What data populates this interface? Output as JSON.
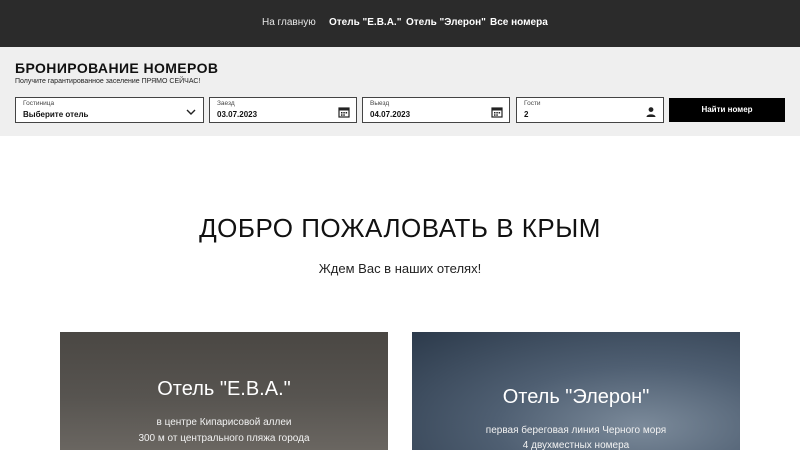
{
  "nav": {
    "items": [
      {
        "label": "На главную"
      },
      {
        "label": "Отель \"Е.В.А.\""
      },
      {
        "label": "Отель \"Элерон\""
      },
      {
        "label": "Все номера"
      }
    ]
  },
  "booking": {
    "title": "БРОНИРОВАНИЕ НОМЕРОВ",
    "subtitle": "Получите гарантированное заселение ПРЯМО СЕЙЧАС!",
    "hotel": {
      "label": "Гостиница",
      "value": "Выберите отель",
      "icon": "chevron-down-icon"
    },
    "checkin": {
      "label": "Заезд",
      "value": "03.07.2023",
      "icon": "calendar-icon"
    },
    "checkout": {
      "label": "Выезд",
      "value": "04.07.2023",
      "icon": "calendar-icon"
    },
    "guests": {
      "label": "Гости",
      "value": "2",
      "icon": "user-icon"
    },
    "find_button": "Найти номер"
  },
  "welcome": {
    "title": "ДОБРО ПОЖАЛОВАТЬ В КРЫМ",
    "subtitle": "Ждем Вас в наших отелях!"
  },
  "cards": [
    {
      "title": "Отель \"Е.В.А.\"",
      "lines": [
        "в центре Кипарисовой аллеи",
        "300 м от центрального пляжа города"
      ]
    },
    {
      "title": "Отель \"Элерон\"",
      "lines": [
        "первая береговая линия Черного моря",
        "4 двухместных номера"
      ]
    }
  ],
  "colors": {
    "nav_bg": "#2b2b2b",
    "booking_bg": "#efefef",
    "button_bg": "#000000"
  }
}
